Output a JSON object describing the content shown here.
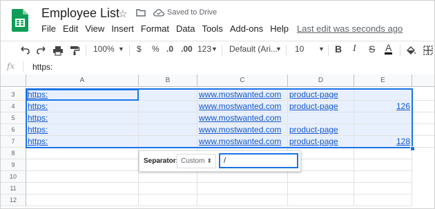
{
  "header": {
    "title": "Employee List",
    "saved_status": "Saved to Drive",
    "last_edit": "Last edit was seconds ago",
    "menu": [
      "File",
      "Edit",
      "View",
      "Insert",
      "Format",
      "Data",
      "Tools",
      "Add-ons",
      "Help"
    ]
  },
  "toolbar": {
    "zoom": "100%",
    "currency": "$",
    "percent": "%",
    "dec_less": ".0",
    "dec_more": ".00",
    "num_format": "123",
    "font": "Default (Ari...",
    "size": "10",
    "bold": "B",
    "italic": "I",
    "strike": "S",
    "textcolor": "A"
  },
  "formula_bar": {
    "fx": "fx",
    "value": "https:"
  },
  "grid": {
    "columns": [
      "A",
      "B",
      "C",
      "D",
      "E"
    ],
    "rows": [
      {
        "n": "3",
        "A": "https:",
        "B": "",
        "C": "www.mostwanted.com",
        "D": "product-page",
        "E": ""
      },
      {
        "n": "4",
        "A": "https:",
        "B": "",
        "C": "www.mostwanted.com",
        "D": "product-page",
        "E": "126"
      },
      {
        "n": "5",
        "A": "https:",
        "B": "",
        "C": "www.mostwanted.com",
        "D": "",
        "E": ""
      },
      {
        "n": "6",
        "A": "https:",
        "B": "",
        "C": "www.mostwanted.com",
        "D": "product-page",
        "E": ""
      },
      {
        "n": "7",
        "A": "https:",
        "B": "",
        "C": "www.mostwanted.com",
        "D": "product-page",
        "E": "128"
      },
      {
        "n": "8",
        "A": "",
        "B": "",
        "C": "",
        "D": "",
        "E": ""
      },
      {
        "n": "9",
        "A": "",
        "B": "",
        "C": "",
        "D": "",
        "E": ""
      },
      {
        "n": "10",
        "A": "",
        "B": "",
        "C": "",
        "D": "",
        "E": ""
      },
      {
        "n": "11",
        "A": "",
        "B": "",
        "C": "",
        "D": "",
        "E": ""
      },
      {
        "n": "12",
        "A": "",
        "B": "",
        "C": "",
        "D": "",
        "E": ""
      }
    ]
  },
  "separator": {
    "label": "Separator:",
    "option": "Custom",
    "value": "/"
  },
  "colors": {
    "accent": "#1a73e8",
    "link": "#1155cc",
    "selection": "#e8f0fe",
    "sheets_green": "#0f9d58"
  }
}
